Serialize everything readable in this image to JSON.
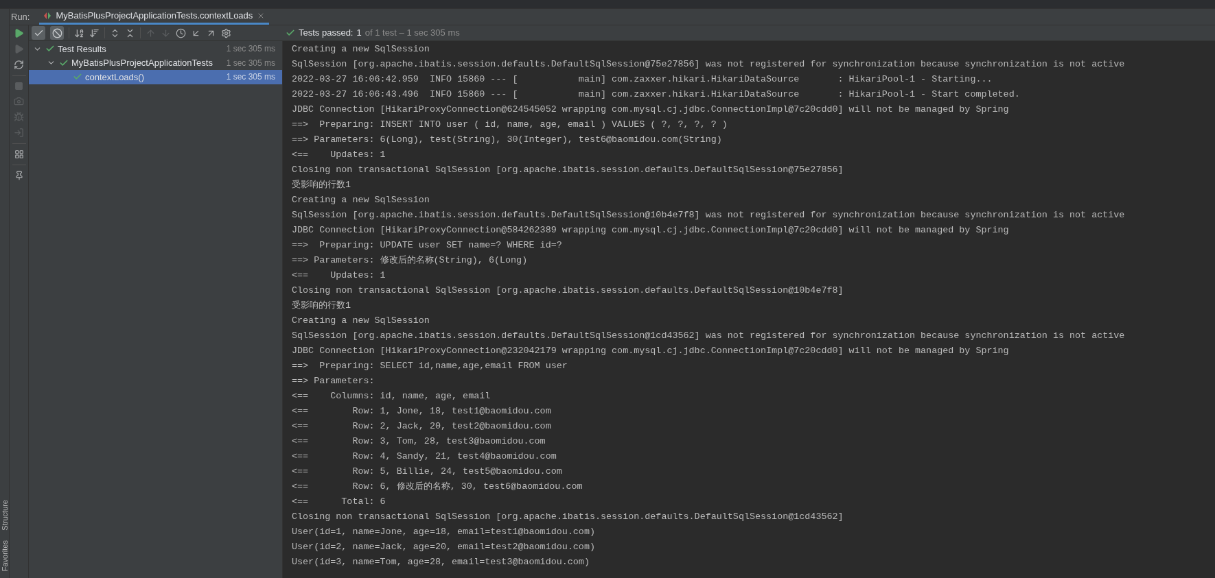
{
  "run_bar": {
    "label": "Run:",
    "tab": {
      "title": "MyBatisPlusProjectApplicationTests.contextLoads",
      "selected": true
    }
  },
  "toolbar": {
    "toggles": [
      {
        "kind": "passed",
        "selected": true
      },
      {
        "kind": "ignored",
        "selected": true
      }
    ],
    "status": {
      "label": "Tests passed:",
      "count": "1",
      "rest": "of 1 test – 1 sec 305 ms"
    }
  },
  "tree": [
    {
      "label": "Test Results",
      "time": "1 sec 305 ms",
      "expanded": true,
      "selected": false,
      "children": [
        {
          "label": "MyBatisPlusProjectApplicationTests",
          "time": "1 sec 305 ms",
          "expanded": true,
          "selected": false,
          "children": [
            {
              "label": "contextLoads()",
              "time": "1 sec 305 ms",
              "selected": true
            }
          ]
        }
      ]
    }
  ],
  "console": {
    "lines": [
      "Creating a new SqlSession",
      "SqlSession [org.apache.ibatis.session.defaults.DefaultSqlSession@75e27856] was not registered for synchronization because synchronization is not active",
      "2022-03-27 16:06:42.959  INFO 15860 --- [           main] com.zaxxer.hikari.HikariDataSource       : HikariPool-1 - Starting...",
      "2022-03-27 16:06:43.496  INFO 15860 --- [           main] com.zaxxer.hikari.HikariDataSource       : HikariPool-1 - Start completed.",
      "JDBC Connection [HikariProxyConnection@624545052 wrapping com.mysql.cj.jdbc.ConnectionImpl@7c20cdd0] will not be managed by Spring",
      "==>  Preparing: INSERT INTO user ( id, name, age, email ) VALUES ( ?, ?, ?, ? )",
      "==> Parameters: 6(Long), test(String), 30(Integer), test6@baomidou.com(String)",
      "<==    Updates: 1",
      "Closing non transactional SqlSession [org.apache.ibatis.session.defaults.DefaultSqlSession@75e27856]",
      "受影响的行数1",
      "Creating a new SqlSession",
      "SqlSession [org.apache.ibatis.session.defaults.DefaultSqlSession@10b4e7f8] was not registered for synchronization because synchronization is not active",
      "JDBC Connection [HikariProxyConnection@584262389 wrapping com.mysql.cj.jdbc.ConnectionImpl@7c20cdd0] will not be managed by Spring",
      "==>  Preparing: UPDATE user SET name=? WHERE id=?",
      "==> Parameters: 修改后的名称(String), 6(Long)",
      "<==    Updates: 1",
      "Closing non transactional SqlSession [org.apache.ibatis.session.defaults.DefaultSqlSession@10b4e7f8]",
      "受影响的行数1",
      "Creating a new SqlSession",
      "SqlSession [org.apache.ibatis.session.defaults.DefaultSqlSession@1cd43562] was not registered for synchronization because synchronization is not active",
      "JDBC Connection [HikariProxyConnection@232042179 wrapping com.mysql.cj.jdbc.ConnectionImpl@7c20cdd0] will not be managed by Spring",
      "==>  Preparing: SELECT id,name,age,email FROM user",
      "==> Parameters: ",
      "<==    Columns: id, name, age, email",
      "<==        Row: 1, Jone, 18, test1@baomidou.com",
      "<==        Row: 2, Jack, 20, test2@baomidou.com",
      "<==        Row: 3, Tom, 28, test3@baomidou.com",
      "<==        Row: 4, Sandy, 21, test4@baomidou.com",
      "<==        Row: 5, Billie, 24, test5@baomidou.com",
      "<==        Row: 6, 修改后的名称, 30, test6@baomidou.com",
      "<==      Total: 6",
      "Closing non transactional SqlSession [org.apache.ibatis.session.defaults.DefaultSqlSession@1cd43562]",
      "User(id=1, name=Jone, age=18, email=test1@baomidou.com)",
      "User(id=2, name=Jack, age=20, email=test2@baomidou.com)",
      "User(id=3, name=Tom, age=28, email=test3@baomidou.com)"
    ]
  },
  "side_labels": [
    "Structure",
    "Favorites"
  ]
}
